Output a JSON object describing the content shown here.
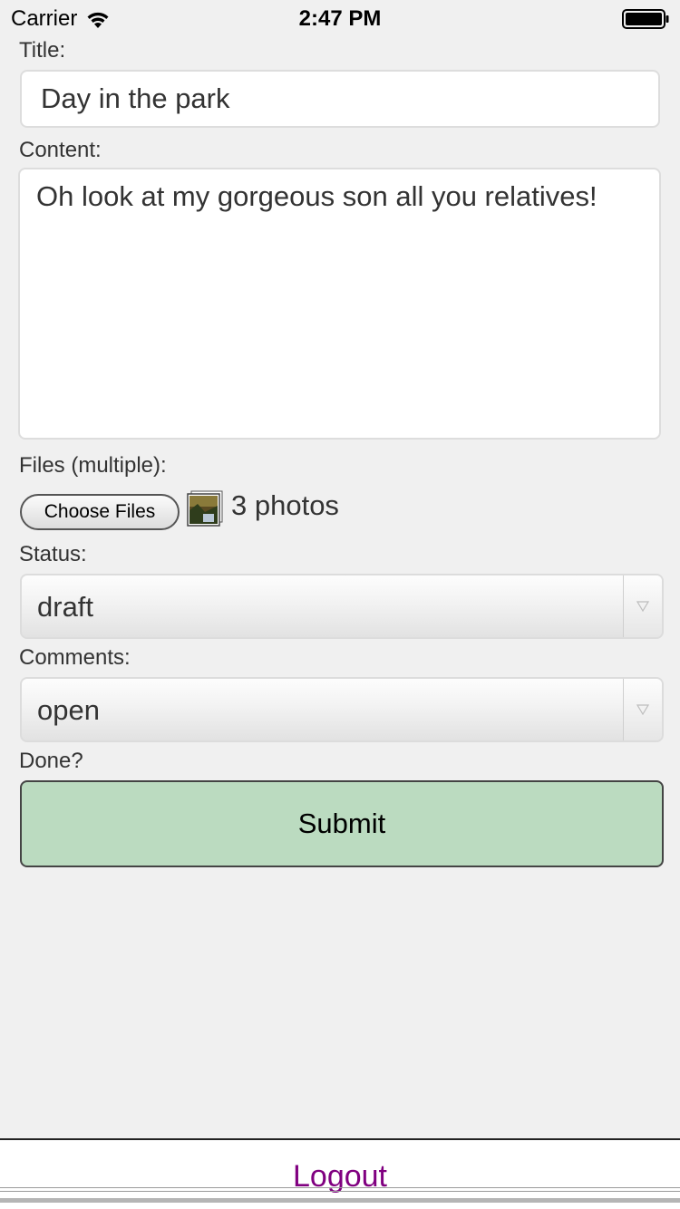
{
  "status_bar": {
    "carrier": "Carrier",
    "time": "2:47 PM",
    "wifi_icon": "wifi-icon",
    "battery_icon": "battery-full-icon"
  },
  "form": {
    "title_label": "Title:",
    "title_value": "Day in the park",
    "content_label": "Content:",
    "content_value": "Oh look at my gorgeous son all you relatives!",
    "files_label": "Files (multiple):",
    "choose_files_label": "Choose Files",
    "files_selected": "3 photos",
    "photo_thumb_icon": "photo-thumbnail-icon",
    "status_label": "Status:",
    "status_value": "draft",
    "comments_label": "Comments:",
    "comments_value": "open",
    "done_label": "Done?",
    "submit_label": "Submit"
  },
  "footer": {
    "logout_label": "Logout"
  },
  "colors": {
    "background": "#f0f0f0",
    "submit_bg": "#bbdbc0",
    "logout_link": "#800080"
  }
}
